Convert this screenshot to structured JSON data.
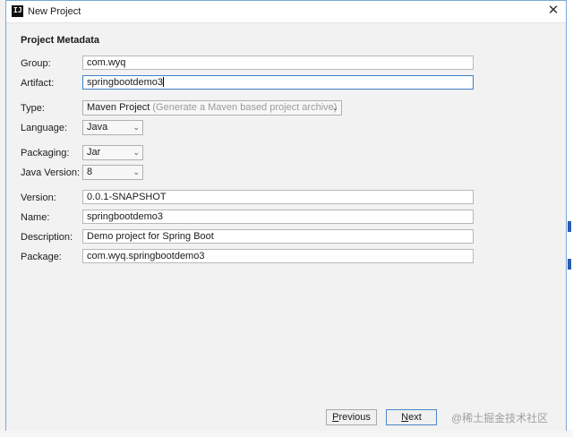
{
  "window": {
    "title": "New Project",
    "app_icon_letters": "IJ",
    "close_glyph": "✕"
  },
  "section_title": "Project Metadata",
  "fields": {
    "group": {
      "label": "Group:",
      "value": "com.wyq"
    },
    "artifact": {
      "label": "Artifact:",
      "value": "springbootdemo3"
    },
    "type": {
      "label": "Type:",
      "value": "Maven Project",
      "hint": "(Generate a Maven based project archive)"
    },
    "language": {
      "label": "Language:",
      "value": "Java"
    },
    "packaging": {
      "label": "Packaging:",
      "value": "Jar"
    },
    "java_version": {
      "label": "Java Version:",
      "value": "8"
    },
    "version": {
      "label": "Version:",
      "value": "0.0.1-SNAPSHOT"
    },
    "name": {
      "label": "Name:",
      "value": "springbootdemo3"
    },
    "description": {
      "label": "Description:",
      "value": "Demo project for Spring Boot"
    },
    "package": {
      "label": "Package:",
      "value": "com.wyq.springbootdemo3"
    }
  },
  "buttons": {
    "previous": {
      "mnemonic": "P",
      "rest": "revious"
    },
    "next": {
      "mnemonic": "N",
      "rest": "ext"
    }
  },
  "watermark": "@稀土掘金技术社区",
  "icons": {
    "dropdown": "chevron-down-icon",
    "close": "close-icon",
    "app": "intellij-icon"
  },
  "colors": {
    "focus_border": "#3d7fc8",
    "dialog_border": "#7aa7d6",
    "content_bg": "#f2f2f2"
  }
}
